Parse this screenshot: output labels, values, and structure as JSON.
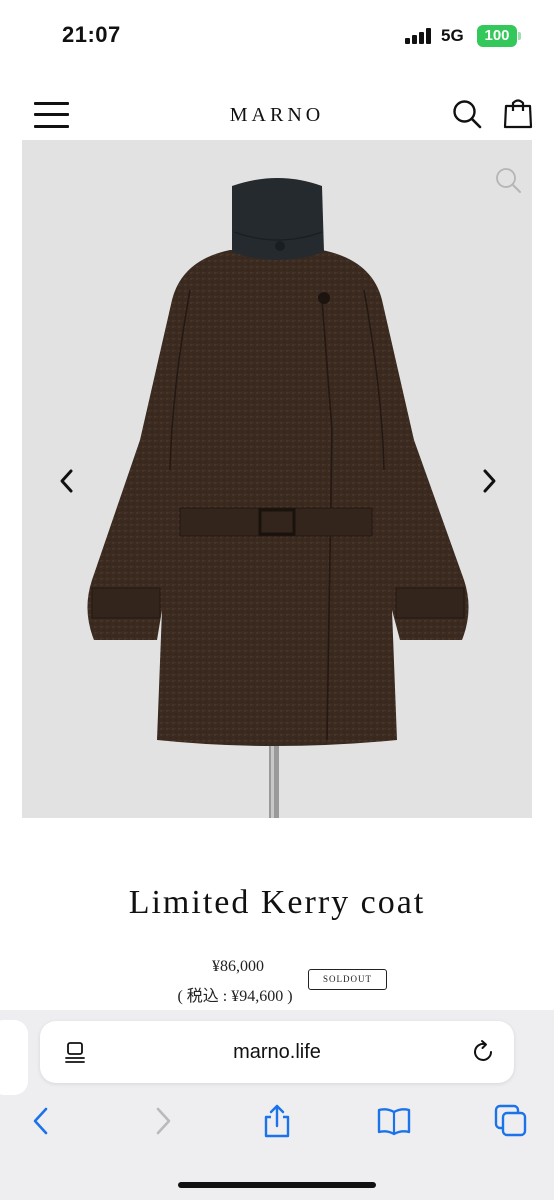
{
  "status_bar": {
    "time": "21:07",
    "network": "5G",
    "battery": "100"
  },
  "header": {
    "brand": "MARNO",
    "menu_icon": "hamburger-menu-icon",
    "search_icon": "search-icon",
    "cart_icon": "shopping-bag-icon"
  },
  "product": {
    "title": "Limited Kerry coat",
    "price": "¥86,000",
    "price_tax": "( 税込 : ¥94,600 )",
    "badge": "SOLDOUT",
    "image_subject": "dark brown wool coat with navy collar and belt on mannequin",
    "image_background": "#e2e2e2"
  },
  "browser": {
    "url": "marno.life",
    "toolbar": [
      "back",
      "forward",
      "share",
      "bookmarks",
      "tabs"
    ],
    "accent": "#1a73e8"
  }
}
